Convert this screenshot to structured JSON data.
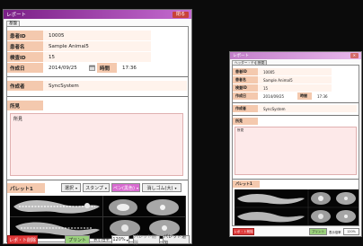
{
  "main_window": {
    "title": "レポート",
    "close_label": "閉る",
    "tab_label": "基盤",
    "fields": {
      "report_id_label": "患者ID",
      "report_id_value": "10005",
      "name_label": "患者名",
      "name_value": "Sample Animal5",
      "animal_id_label": "検査ID",
      "animal_id_value": "15",
      "date_label": "作成日",
      "date_value": "2014/09/25",
      "time_label": "時間",
      "time_value": "17:36",
      "author_label": "作成者",
      "author_value": "SyncSystem",
      "findings_label": "所見",
      "notes_text": "所見"
    },
    "palette_label": "パレット1",
    "toolbar": {
      "select_label": "選択",
      "stamp_label": "スタンプ",
      "pen_label": "ペン(黒色)",
      "eraser_label": "消しゴム(大)"
    },
    "footer": {
      "report_button_label": "レポ・ト削除",
      "print_button_label": "プリント",
      "zoom_label": "表示倍率",
      "zoom_value": "120%",
      "palette_remove_label": "パレット削除",
      "palette_add_label": "パレット追加"
    }
  },
  "secondary_window": {
    "title": "レポート",
    "tab1": "ヘッダー・テキスト",
    "tab2": "所見",
    "fields": {
      "report_id_label": "患者ID",
      "report_id_value": "10005",
      "name_label": "患者名",
      "name_value": "Sample Animal5",
      "animal_id_label": "検査ID",
      "animal_id_value": "15",
      "date_label": "作成日",
      "date_value": "2014/09/25",
      "time_label": "時間",
      "time_value": "17:36",
      "author_label": "作成者",
      "author_value": "SyncSystem",
      "findings_label": "所見",
      "notes_text": "所見"
    },
    "palette_label": "パレット1",
    "footer": {
      "report_button_label": "レポ・ト削除",
      "print_button_label": "プリント",
      "zoom_label": "表示倍率",
      "zoom_value": "120%"
    }
  },
  "colors": {
    "titlebar_left": "#7a1f86",
    "titlebar_right": "#c56bd0",
    "label_bg": "#f4c9ae",
    "notes_bg": "#fde9e9",
    "delete_red": "#e03b3b",
    "print_green": "#9ad07c",
    "pen_magenta": "#d86bd0"
  }
}
